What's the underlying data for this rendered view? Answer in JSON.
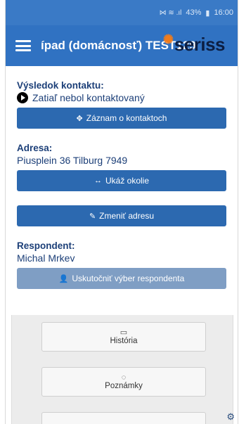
{
  "status_bar": {
    "icons_text": "⋈ ≋ .ıl",
    "battery": "43%",
    "time": "16:00"
  },
  "app_bar": {
    "title": "ípad (domácnosť) TEST129",
    "logo_text": "seriss"
  },
  "result": {
    "label": "Výsledok kontaktu:",
    "value": "Zatiaľ nebol kontaktovaný",
    "button": "Záznam o kontaktoch"
  },
  "address": {
    "label": "Adresa:",
    "value": "Piusplein 36 Tilburg 7949",
    "show_button": "Ukáž okolie",
    "change_button": "Zmeniť adresu"
  },
  "respondent": {
    "label": "Respondent:",
    "value": "Michal Mrkev",
    "button": "Uskutočniť výber respondenta"
  },
  "tiles": {
    "history": "História",
    "notes": "Poznámky"
  },
  "colors": {
    "app_bar": "#3072c2",
    "primary_button": "#2c69b0",
    "disabled_button": "#7f9ec4",
    "text_blue": "#1c3f78"
  }
}
